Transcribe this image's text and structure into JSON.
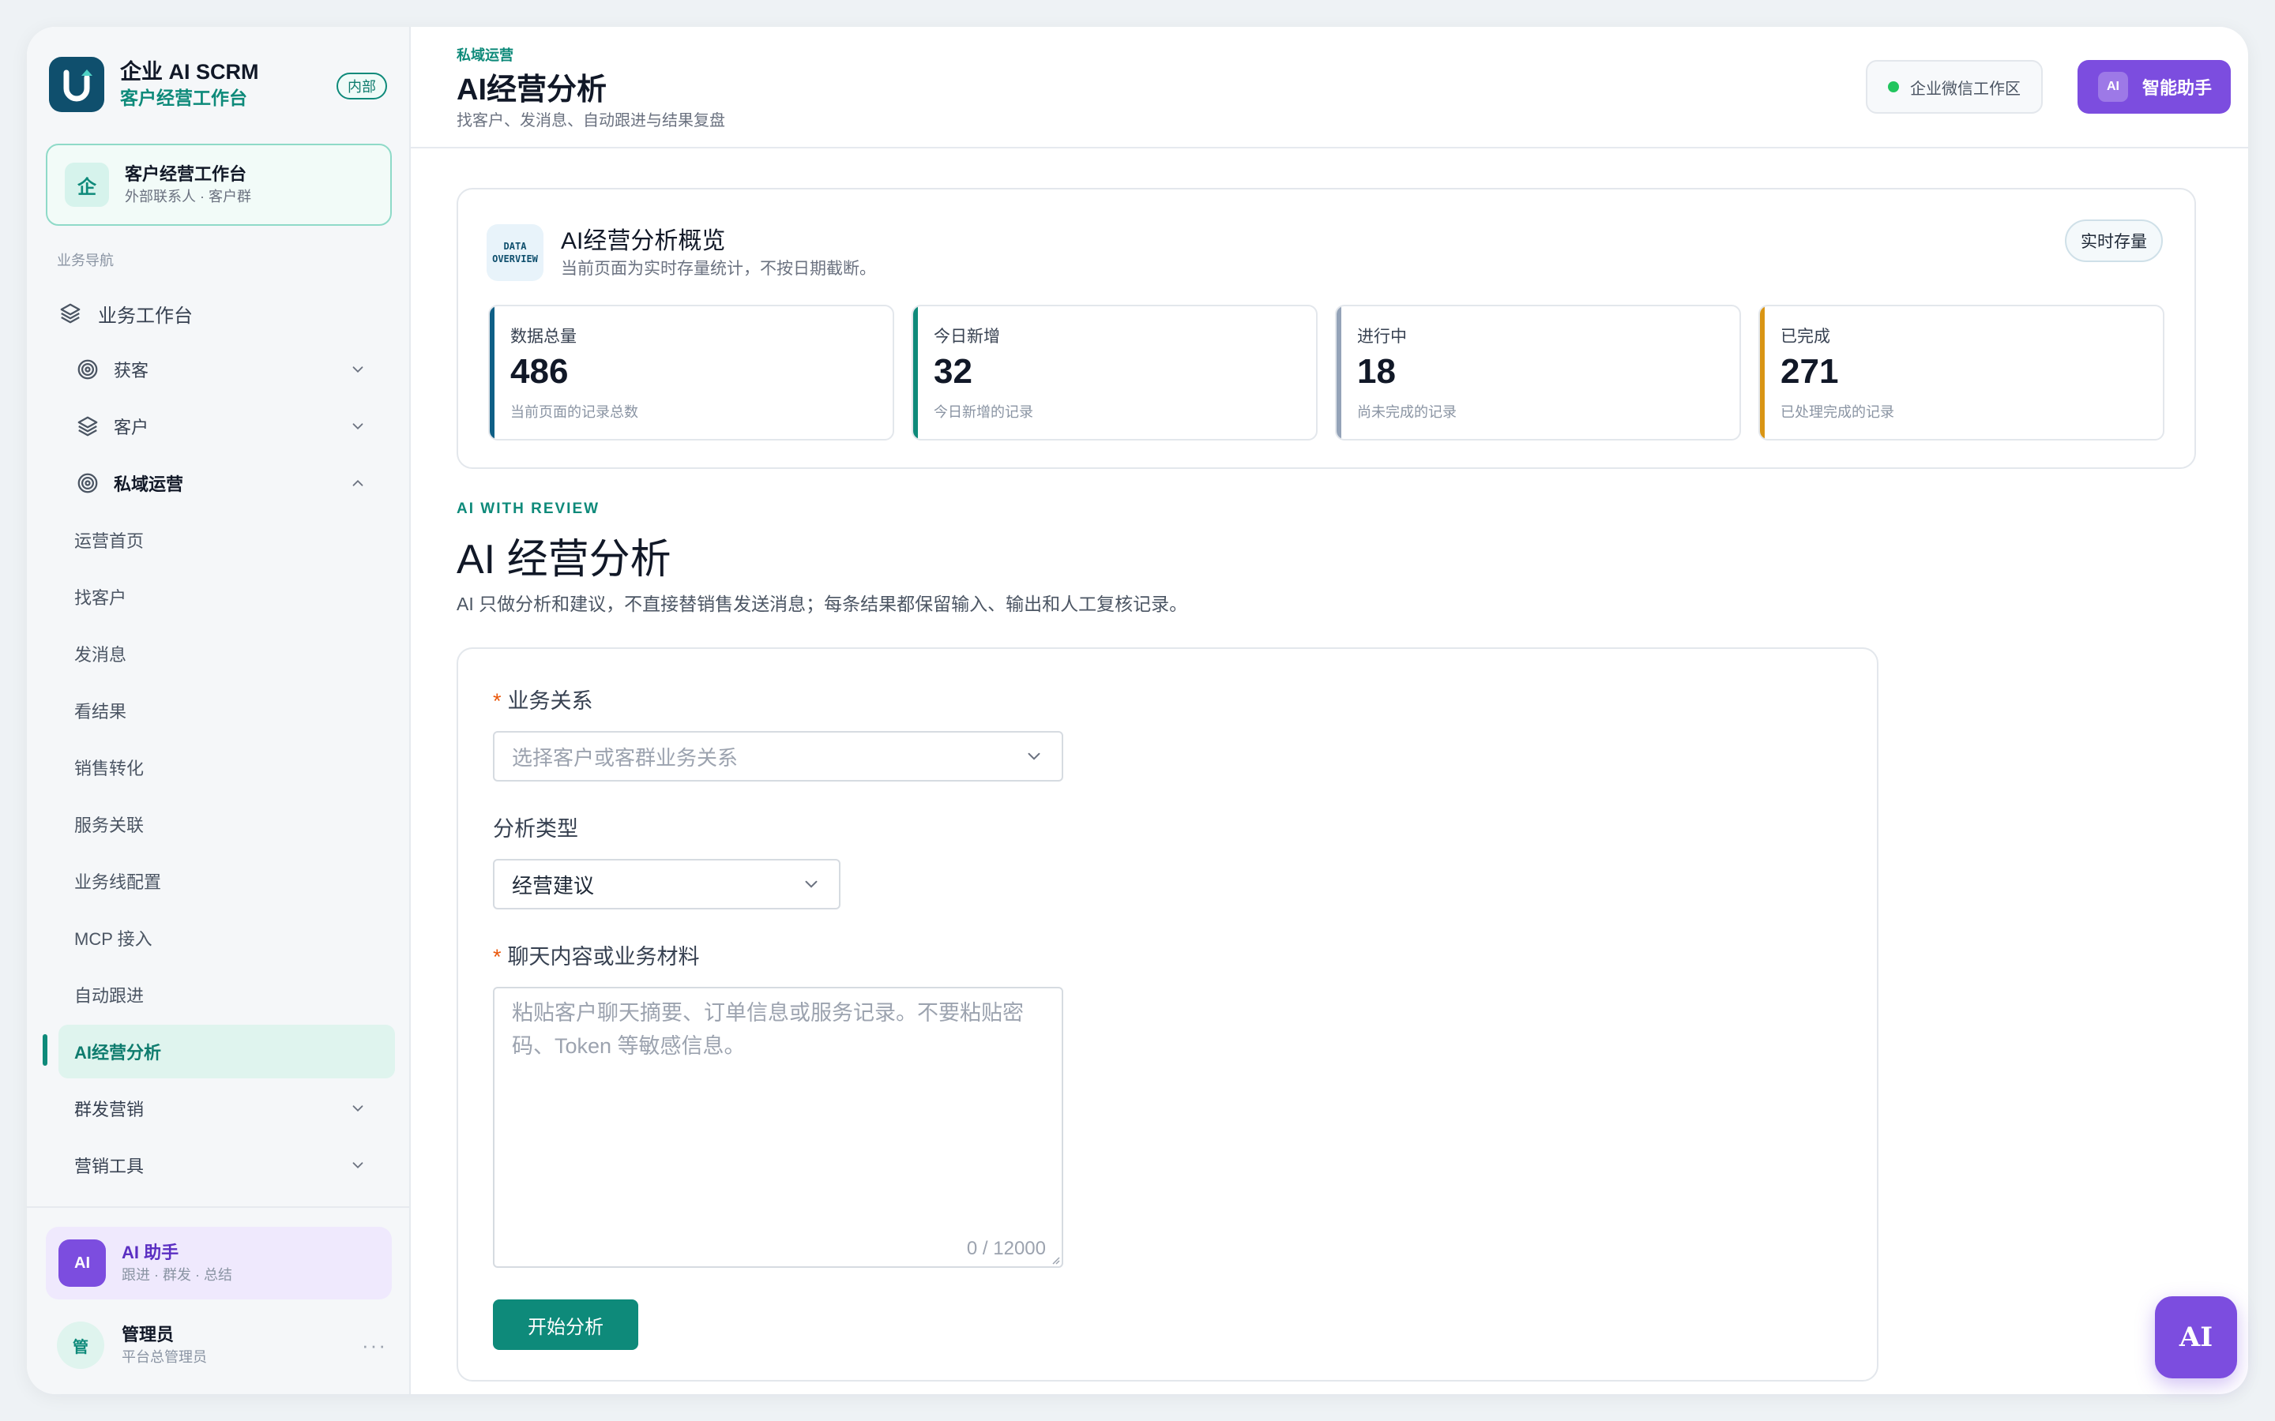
{
  "brand": {
    "title": "企业 AI SCRM",
    "subtitle": "客户经营工作台",
    "tag": "内部"
  },
  "workspace": {
    "icon_text": "企",
    "title": "客户经营工作台",
    "subtitle": "外部联系人 · 客户群"
  },
  "nav_section": "业务导航",
  "nav": {
    "top": {
      "label": "业务工作台",
      "icon": "layers-icon"
    },
    "groups": [
      {
        "label": "获客",
        "icon": "target-icon"
      },
      {
        "label": "客户",
        "icon": "layers-icon"
      },
      {
        "label": "私域运营",
        "icon": "target-icon"
      }
    ],
    "sub_items": [
      "运营首页",
      "找客户",
      "发消息",
      "看结果",
      "销售转化",
      "服务关联",
      "业务线配置",
      "MCP 接入",
      "自动跟进",
      "AI经营分析"
    ],
    "after_groups": [
      "群发营销",
      "营销工具"
    ]
  },
  "assistant_card": {
    "badge": "AI",
    "title": "AI 助手",
    "subtitle": "跟进 · 群发 · 总结"
  },
  "user": {
    "avatar": "管",
    "name": "管理员",
    "role": "平台总管理员",
    "more": "···"
  },
  "header": {
    "breadcrumb": "私域运营",
    "title": "AI经营分析",
    "subtitle": "找客户、发消息、自动跟进与结果复盘",
    "workspace_chip": "企业微信工作区",
    "ai_button_badge": "AI",
    "ai_button_label": "智能助手"
  },
  "overview": {
    "icon_line1": "DATA",
    "icon_line2": "OVERVIEW",
    "title": "AI经营分析概览",
    "subtitle": "当前页面为实时存量统计，不按日期截断。",
    "chip": "实时存量",
    "stats": [
      {
        "label": "数据总量",
        "value": "486",
        "desc": "当前页面的记录总数",
        "color": "#0f5f86"
      },
      {
        "label": "今日新增",
        "value": "32",
        "desc": "今日新增的记录",
        "color": "#0e8a7a"
      },
      {
        "label": "进行中",
        "value": "18",
        "desc": "尚未完成的记录",
        "color": "#94a3b8"
      },
      {
        "label": "已完成",
        "value": "271",
        "desc": "已处理完成的记录",
        "color": "#d99514"
      }
    ]
  },
  "section": {
    "eyebrow": "AI WITH REVIEW",
    "title": "AI 经营分析",
    "subtitle": "AI 只做分析和建议，不直接替销售发送消息；每条结果都保留输入、输出和人工复核记录。"
  },
  "form": {
    "relation": {
      "required": "*",
      "label": "业务关系",
      "placeholder": "选择客户或客群业务关系"
    },
    "analysis_type": {
      "label": "分析类型",
      "value": "经营建议"
    },
    "content": {
      "required": "*",
      "label": "聊天内容或业务材料",
      "placeholder": "粘贴客户聊天摘要、订单信息或服务记录。不要粘贴密码、Token 等敏感信息。",
      "counter": "0 / 12000"
    },
    "submit": "开始分析"
  },
  "fab": "AI",
  "colors": {
    "accent": "#0e8a7a",
    "brand_purple": "#7c4ddf",
    "logo": "#0f4f6d"
  }
}
